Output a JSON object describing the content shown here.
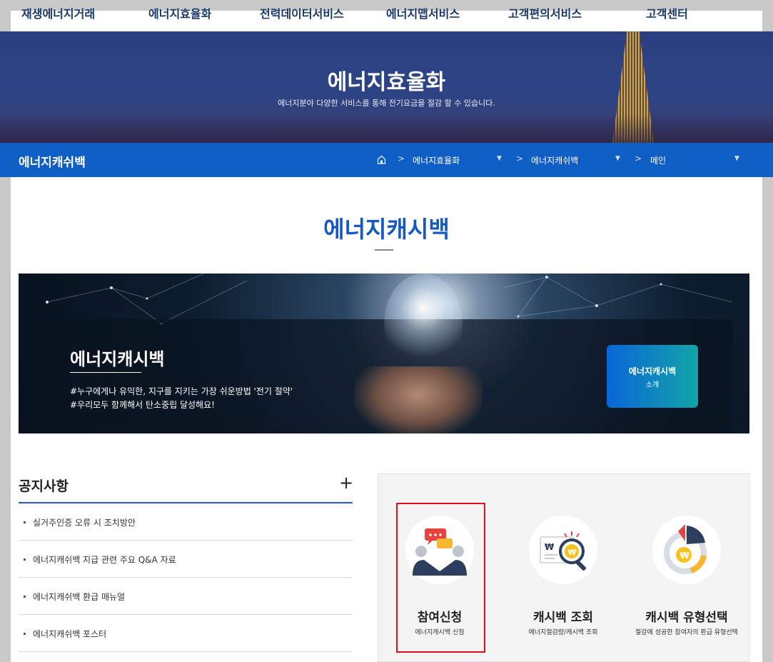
{
  "nav": {
    "items": [
      "재생에너지거래",
      "에너지효율화",
      "전력데이터서비스",
      "에너지맵서비스",
      "고객편의서비스",
      "고객센터"
    ]
  },
  "hero": {
    "title": "에너지효율화",
    "subtitle": "에너지분야 다양한 서비스를 통해 전기요금을 절감 할 수 있습니다."
  },
  "bar": {
    "section": "에너지캐쉬백",
    "breadcrumb": [
      "에너지효율화",
      "에너지캐쉬백",
      "메인"
    ]
  },
  "main": {
    "title": "에너지캐시백"
  },
  "banner": {
    "title": "에너지캐시백",
    "line1": "#누구에게나 유익한, 지구를 지키는 가장 쉬운방법 '전기 절약'",
    "line2": "#우리모두 함께해서 탄소중립 달성해요!",
    "btn_line1": "에너지캐시백",
    "btn_line2": "소개"
  },
  "notice": {
    "title": "공지사항",
    "plus": "+",
    "items": [
      "실거주인증 오류 시 조치방안",
      "에너지캐쉬백 지급 관련 주요 Q&A 자료",
      "에너지캐쉬백 환급 매뉴얼",
      "에너지캐쉬백 포스터"
    ]
  },
  "services": [
    {
      "title": "참여신청",
      "sub": "에너지캐시백 신청"
    },
    {
      "title": "캐시백 조회",
      "sub": "에너지절감량/캐시백 조회"
    },
    {
      "title": "캐시백 유형선택",
      "sub": "절감에 성공한 참여자의 환급 유형선택"
    }
  ],
  "icons": {
    "home": "home-icon",
    "apply": "chat-people-icon",
    "lookup": "magnifier-coin-icon",
    "type": "pie-coin-icon"
  },
  "colors": {
    "brand_blue": "#0f5ec6",
    "title_blue": "#1559c5",
    "highlight_red": "#e0101a"
  }
}
